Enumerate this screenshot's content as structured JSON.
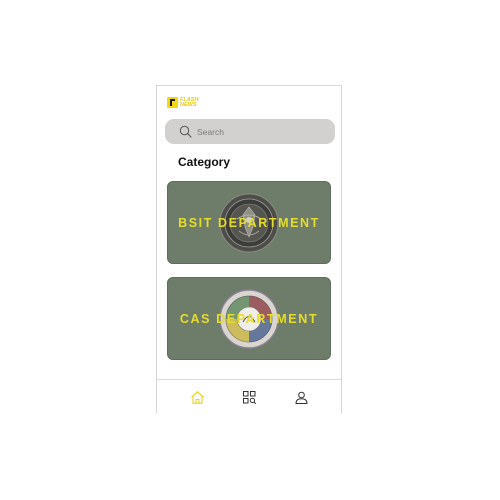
{
  "app": {
    "logo_line1": "FLASH",
    "logo_line2": "NEWS"
  },
  "search": {
    "placeholder": "Search",
    "icon": "search-icon"
  },
  "category": {
    "title": "Category",
    "cards": [
      {
        "label": "BSIT DEPARTMENT",
        "emblem": "bsit-seal"
      },
      {
        "label": "CAS DEPARTMENT",
        "emblem": "cas-seal"
      }
    ]
  },
  "nav": {
    "items": [
      {
        "icon": "home-icon",
        "active": true
      },
      {
        "icon": "category-search-icon",
        "active": false
      },
      {
        "icon": "profile-icon",
        "active": false
      }
    ]
  },
  "colors": {
    "brand_yellow": "#f4d80f",
    "card_green": "#6e7d6a",
    "card_label": "#e6dc2e",
    "search_bg": "#d2d1cf",
    "nav_active": "#e6d321",
    "nav_inactive": "#333333"
  }
}
